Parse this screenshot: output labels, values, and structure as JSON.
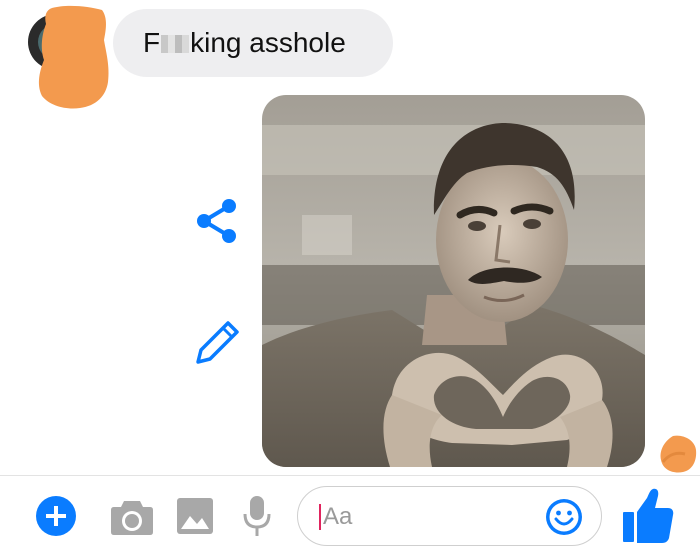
{
  "thread": {
    "incoming_message": {
      "text_before": "F",
      "text_after": "king asshole",
      "censored": true
    },
    "outgoing_photo": {
      "kind": "sepia portrait photo of a man making a heart shape with his hands"
    },
    "actions": {
      "share_icon": "share-icon",
      "edit_icon": "pencil-icon"
    },
    "read_receipt": "avatar"
  },
  "composer": {
    "input_placeholder": "Aa",
    "icons": [
      "plus-icon",
      "camera-icon",
      "gallery-icon",
      "microphone-icon",
      "emoji-icon",
      "thumbs-up-icon"
    ]
  },
  "colors": {
    "accent": "#0a7cff",
    "bubble": "#eeeef0",
    "redaction": "#f39a4e",
    "icon_gray": "#a8a8a8"
  }
}
